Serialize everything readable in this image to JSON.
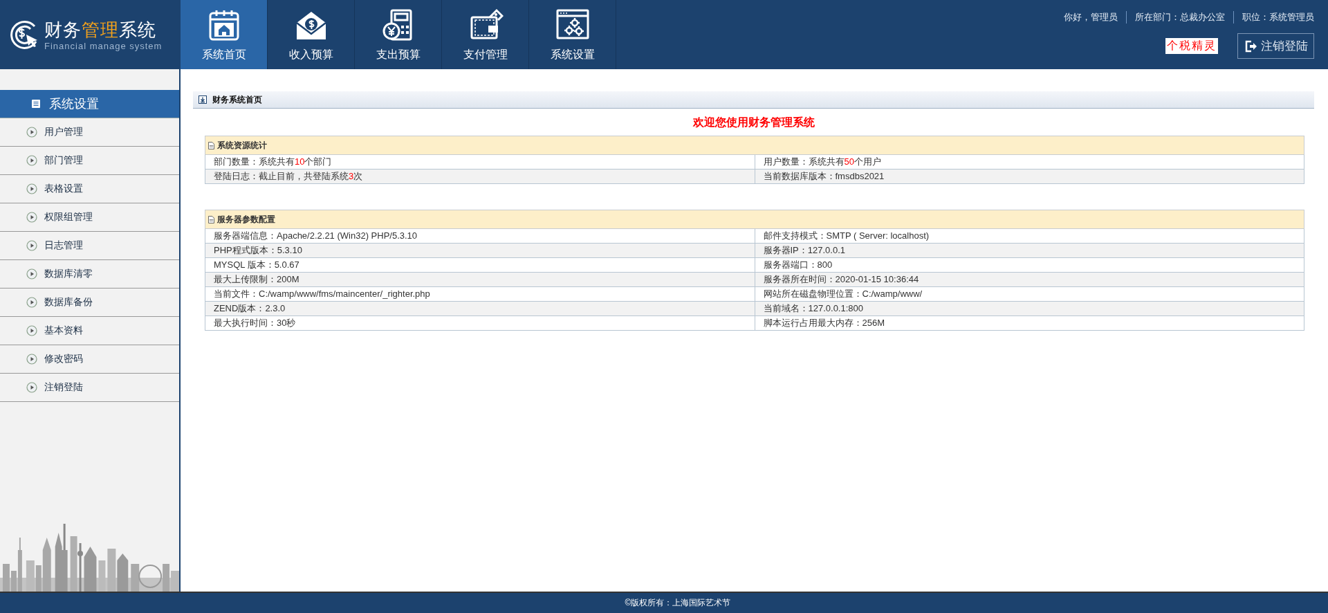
{
  "logo": {
    "title_parts": [
      {
        "text": "财务",
        "highlight": false
      },
      {
        "text": "管理",
        "highlight": true
      },
      {
        "text": "系统",
        "highlight": false
      }
    ],
    "subtitle": "Financial manage system"
  },
  "nav_tabs": [
    {
      "label": "系统首页",
      "kind": "home",
      "selected": true
    },
    {
      "label": "收入预算",
      "kind": "income",
      "selected": false
    },
    {
      "label": "支出预算",
      "kind": "expense",
      "selected": false
    },
    {
      "label": "支付管理",
      "kind": "payment",
      "selected": false
    },
    {
      "label": "系统设置",
      "kind": "settings",
      "selected": false
    }
  ],
  "user_info": [
    "你好，管理员",
    "所在部门：总裁办公室",
    "职位：系统管理员"
  ],
  "tax_link": "个税精灵",
  "logout_button": "注销登陆",
  "sidebar": {
    "title": "系统设置",
    "items": [
      "用户管理",
      "部门管理",
      "表格设置",
      "权限组管理",
      "日志管理",
      "数据库清零",
      "数据库备份",
      "基本资料",
      "修改密码",
      "注销登陆"
    ]
  },
  "breadcrumb": "财务系统首页",
  "welcome": "欢迎您使用财务管理系统",
  "panels": [
    {
      "title": "系统资源统计",
      "rows": [
        [
          {
            "text": "部门数量：系统共有",
            "count": "10",
            "after": "个部门"
          },
          {
            "text": "用户数量：系统共有",
            "count": "50",
            "after": "个用户"
          }
        ],
        [
          {
            "text": "登陆日志：截止目前，共登陆系统",
            "count": "3",
            "after": "次"
          },
          {
            "text": "当前数据库版本：fmsdbs2021"
          }
        ]
      ]
    },
    {
      "title": "服务器参数配置",
      "rows": [
        [
          {
            "text": "服务器端信息：Apache/2.2.21 (Win32) PHP/5.3.10"
          },
          {
            "text": "邮件支持模式：SMTP ( Server: localhost)"
          }
        ],
        [
          {
            "text": "PHP程式版本：5.3.10"
          },
          {
            "text": "服务器IP：127.0.0.1"
          }
        ],
        [
          {
            "text": "MYSQL 版本：5.0.67"
          },
          {
            "text": "服务器端口：800"
          }
        ],
        [
          {
            "text": "最大上传限制：200M"
          },
          {
            "text": "服务器所在时间：2020-01-15 10:36:44"
          }
        ],
        [
          {
            "text": "当前文件：C:/wamp/www/fms/maincenter/_righter.php"
          },
          {
            "text": "网站所在磁盘物理位置：C:/wamp/www/"
          }
        ],
        [
          {
            "text": "ZEND版本：2.3.0"
          },
          {
            "text": "当前域名：127.0.0.1:800"
          }
        ],
        [
          {
            "text": "最大执行时间：30秒"
          },
          {
            "text": "脚本运行占用最大内存：256M"
          }
        ]
      ]
    }
  ],
  "footer": "©版权所有：上海国际艺术节"
}
